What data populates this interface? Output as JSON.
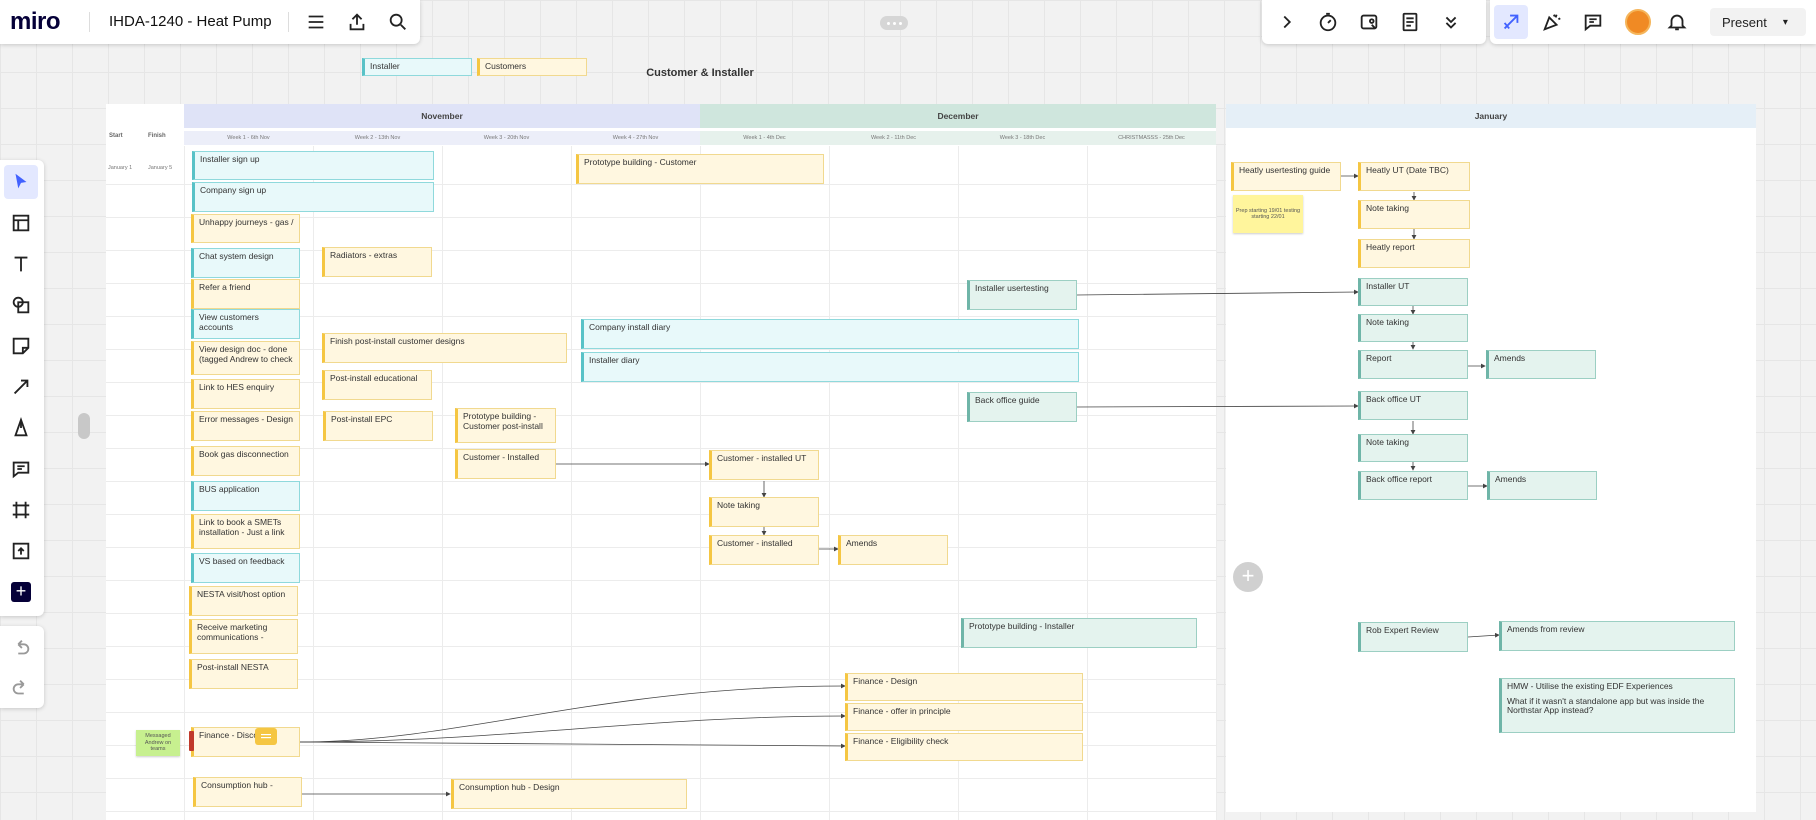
{
  "app": {
    "logo": "miro",
    "board_title": "IHDA-1240 - Heat Pump",
    "present_label": "Present"
  },
  "colors": {
    "accent": "#4262ff",
    "november": "#dfe3f7",
    "december": "#cfe6dd",
    "january": "#e5eff7",
    "sticky_yellow": "#fff59c",
    "sticky_green": "#c7f08f"
  },
  "legend": {
    "installer": "Installer",
    "customers": "Customers"
  },
  "board_heading": "Customer & Installer",
  "months": {
    "november": "November",
    "december": "December",
    "january": "January"
  },
  "columns": {
    "start": "Start",
    "finish": "Finish",
    "start_value": "January 1",
    "finish_value": "January 5"
  },
  "weeks": [
    "Week 1 - 6th Nov",
    "Week 2 - 13th Nov",
    "Week 3 - 20th Nov",
    "Week 4 - 27th Nov",
    "Week 1 - 4th Dec",
    "Week 2 - 11th Dec",
    "Week 3 - 18th Dec",
    "CHRISTMASSS - 25th Dec"
  ],
  "cards": {
    "installer_signup": "Installer sign up",
    "company_signup": "Company sign up",
    "unhappy": "Unhappy journeys - gas /",
    "chat": "Chat system design",
    "refer": "Refer a friend",
    "view_accounts": "View customers accounts",
    "view_design": "View design doc - done (tagged Andrew to check",
    "link_hes": "Link to HES enquiry",
    "error_msg": "Error messages - Design",
    "book_gas": "Book gas disconnection",
    "bus": "BUS application",
    "link_smets": "Link to book a SMETs installation - Just a link",
    "vs_feedback": "VS based on feedback",
    "nesta_visit": "NESTA visit/host option",
    "receive_marketing": "Receive marketing communications -",
    "post_nesta": "Post-install NESTA",
    "finance_disco": "Finance - Disco",
    "consumption_hub": "Consumption hub -",
    "radiators": "Radiators - extras",
    "finish_post": "Finish post-install customer designs",
    "post_educational": "Post-install educational",
    "post_epc": "Post-install EPC",
    "proto_customer_post": "Prototype building - Customer post-install",
    "customer_installed": "Customer - Installed",
    "consumption_design": "Consumption hub - Design",
    "proto_customer": "Prototype building - Customer",
    "company_diary": "Company install diary",
    "installer_diary": "Installer diary",
    "customer_installed_ut": "Customer - installed UT",
    "note_taking_dec": "Note taking",
    "customer_installed_2": "Customer - installed",
    "amends_dec": "Amends",
    "finance_design": "Finance - Design",
    "finance_offer": "Finance - offer in principle",
    "finance_eligibility": "Finance - Eligibility check",
    "installer_ut_dec": "Installer usertesting",
    "back_office_guide": "Back office guide",
    "proto_installer": "Prototype building - Installer",
    "heatly_guide": "Heatly usertesting guide",
    "heatly_ut": "Heatly UT (Date TBC)",
    "note_taking_1": "Note taking",
    "heatly_report": "Heatly report",
    "installer_ut": "Installer UT",
    "note_taking_2": "Note taking",
    "report": "Report",
    "amends_1": "Amends",
    "back_office_ut": "Back office UT",
    "note_taking_3": "Note taking",
    "back_office_report": "Back office report",
    "amends_2": "Amends",
    "rob_review": "Rob Expert Review",
    "amends_review": "Amends from review",
    "hmw_1": "HMW - Utilise the existing EDF Experiences",
    "hmw_2": "What if it wasn't a standalone app but was inside the Northstar App instead?"
  },
  "stickies": {
    "messaged": "Messaged Andrew on teams",
    "prep": "Prep starting 19/01 testing starting 22/01"
  },
  "icons": [
    "menu-icon",
    "upload-icon",
    "search-icon",
    "chevron-right-icon",
    "timer-icon",
    "present-board-icon",
    "notes-icon",
    "chevrons-down-icon",
    "reactions-icon",
    "celebrate-icon",
    "comment-icon",
    "avatar",
    "bell-icon",
    "select-tool-icon",
    "template-icon",
    "text-icon",
    "shapes-icon",
    "sticky-note-icon",
    "connector-icon",
    "pen-icon",
    "comment-tool-icon",
    "frame-icon",
    "upload-tool-icon",
    "plus-icon",
    "undo-icon",
    "redo-icon"
  ]
}
